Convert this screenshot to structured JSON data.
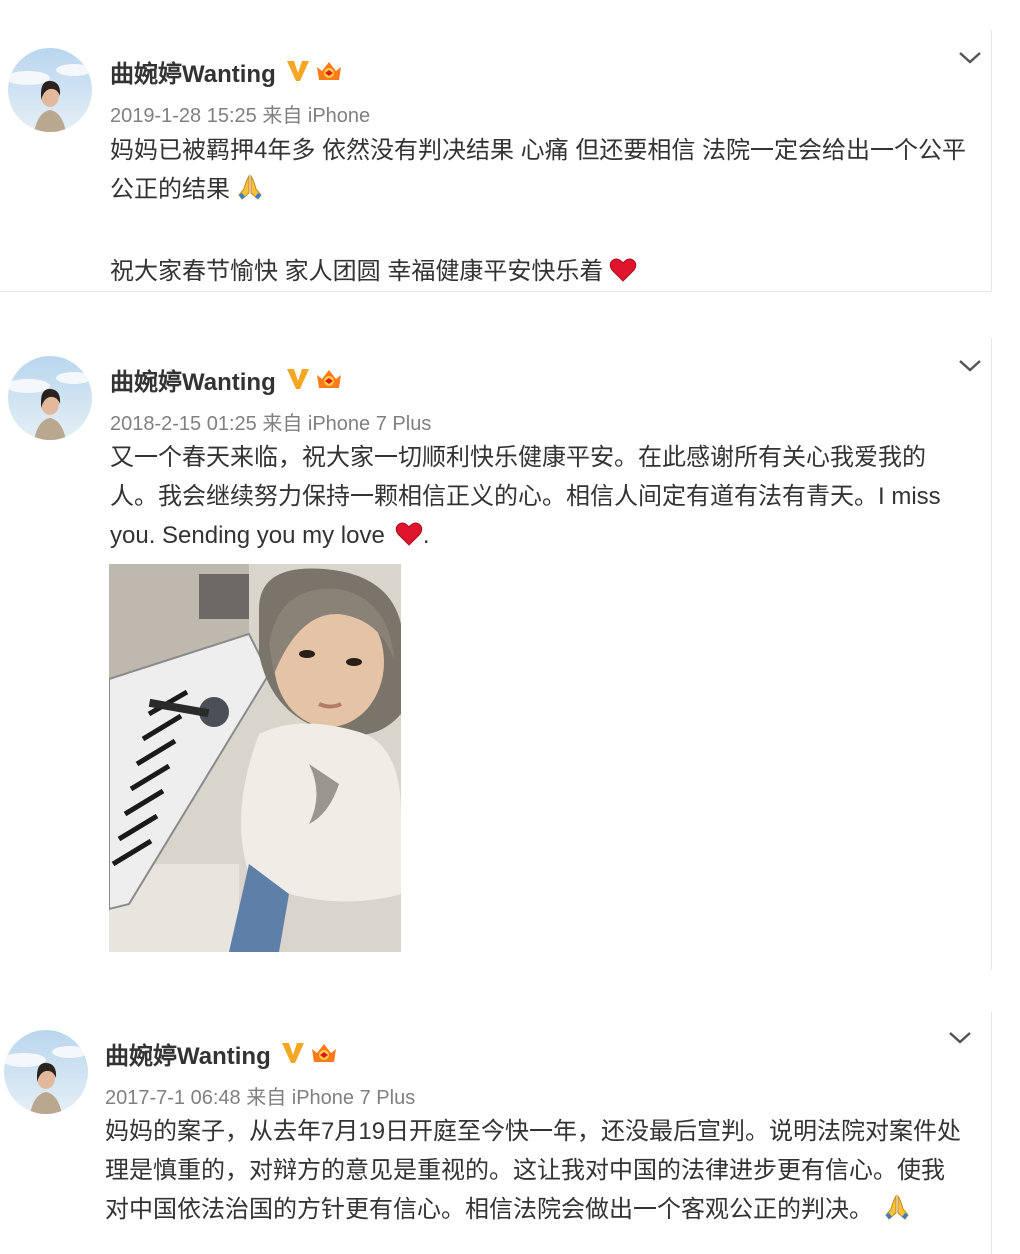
{
  "posts": [
    {
      "username": "曲婉婷Wanting",
      "meta": "2019-1-28 15:25 来自 iPhone",
      "text_lines": [
        "妈妈已被羁押4年多 依然没有判决结果 心痛 但还要相信 法院一定会给出一个公平",
        "公正的结果"
      ],
      "text_second": "祝大家春节愉快 家人团圆 幸福健康平安快乐着",
      "icons": [
        "verified-v-icon",
        "crown-badge-icon",
        "praying-hands-emoji",
        "red-heart-emoji",
        "chevron-down-icon"
      ]
    },
    {
      "username": "曲婉婷Wanting",
      "meta": "2018-2-15 01:25 来自 iPhone 7 Plus",
      "text_lines": [
        "又一个春天来临，祝大家一切顺利快乐健康平安。在此感谢所有关心我爱我的",
        "人。我会继续努力保持一颗相信正义的心。相信人间定有道有法有青天。I miss",
        "you. Sending you my love",
        "."
      ],
      "icons": [
        "verified-v-icon",
        "crown-badge-icon",
        "red-heart-emoji",
        "chevron-down-icon"
      ]
    },
    {
      "username": "曲婉婷Wanting",
      "meta": "2017-7-1 06:48 来自 iPhone 7 Plus",
      "text_lines": [
        "妈妈的案子，从去年7月19日开庭至今快一年，还没最后宣判。说明法院对案件处",
        "理是慎重的，对辩方的意见是重视的。这让我对中国的法律进步更有信心。使我",
        "对中国依法治国的方针更有信心。相信法院会做出一个客观公正的判决。"
      ],
      "icons": [
        "verified-v-icon",
        "crown-badge-icon",
        "praying-hands-emoji",
        "chevron-down-icon"
      ]
    }
  ],
  "colors": {
    "text": "#333333",
    "meta": "#808080",
    "verified": "#f5a623",
    "heart": "#e0142b",
    "border": "#e6e6e6"
  }
}
